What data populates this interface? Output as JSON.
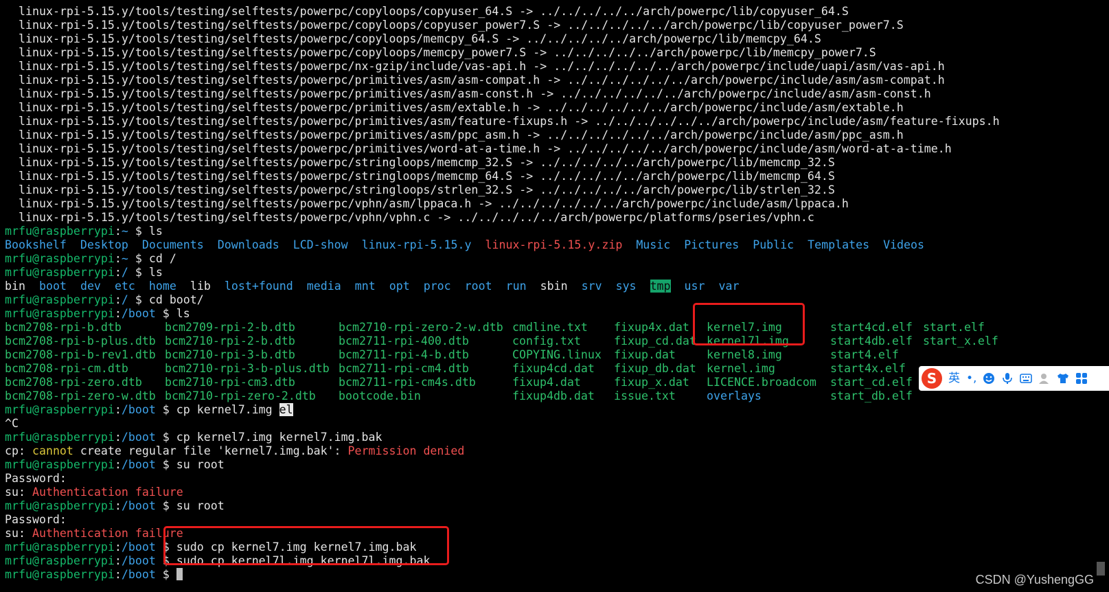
{
  "prompt": {
    "user": "mrfu@raspberrypi",
    "sep": ":",
    "dollar": " $ "
  },
  "symlink_lines": [
    "linux-rpi-5.15.y/tools/testing/selftests/powerpc/copyloops/copyuser_64.S -> ../../../../../arch/powerpc/lib/copyuser_64.S",
    "linux-rpi-5.15.y/tools/testing/selftests/powerpc/copyloops/copyuser_power7.S -> ../../../../../arch/powerpc/lib/copyuser_power7.S",
    "linux-rpi-5.15.y/tools/testing/selftests/powerpc/copyloops/memcpy_64.S -> ../../../../../arch/powerpc/lib/memcpy_64.S",
    "linux-rpi-5.15.y/tools/testing/selftests/powerpc/copyloops/memcpy_power7.S -> ../../../../../arch/powerpc/lib/memcpy_power7.S",
    "linux-rpi-5.15.y/tools/testing/selftests/powerpc/nx-gzip/include/vas-api.h -> ../../../../../../arch/powerpc/include/uapi/asm/vas-api.h",
    "linux-rpi-5.15.y/tools/testing/selftests/powerpc/primitives/asm/asm-compat.h -> ../../../../../../arch/powerpc/include/asm/asm-compat.h",
    "linux-rpi-5.15.y/tools/testing/selftests/powerpc/primitives/asm/asm-const.h -> ../../../../../../arch/powerpc/include/asm/asm-const.h",
    "linux-rpi-5.15.y/tools/testing/selftests/powerpc/primitives/asm/extable.h -> ../../../../../../arch/powerpc/include/asm/extable.h",
    "linux-rpi-5.15.y/tools/testing/selftests/powerpc/primitives/asm/feature-fixups.h -> ../../../../../../arch/powerpc/include/asm/feature-fixups.h",
    "linux-rpi-5.15.y/tools/testing/selftests/powerpc/primitives/asm/ppc_asm.h -> ../../../../../../arch/powerpc/include/asm/ppc_asm.h",
    "linux-rpi-5.15.y/tools/testing/selftests/powerpc/primitives/word-at-a-time.h -> ../../../../../arch/powerpc/include/asm/word-at-a-time.h",
    "linux-rpi-5.15.y/tools/testing/selftests/powerpc/stringloops/memcmp_32.S -> ../../../../../arch/powerpc/lib/memcmp_32.S",
    "linux-rpi-5.15.y/tools/testing/selftests/powerpc/stringloops/memcmp_64.S -> ../../../../../arch/powerpc/lib/memcmp_64.S",
    "linux-rpi-5.15.y/tools/testing/selftests/powerpc/stringloops/strlen_32.S -> ../../../../../arch/powerpc/lib/strlen_32.S",
    "linux-rpi-5.15.y/tools/testing/selftests/powerpc/vphn/asm/lppaca.h -> ../../../../../../arch/powerpc/include/asm/lppaca.h",
    "linux-rpi-5.15.y/tools/testing/selftests/powerpc/vphn/vphn.c -> ../../../../../arch/powerpc/platforms/pseries/vphn.c"
  ],
  "cmd1": {
    "path": "~",
    "cmd": "ls"
  },
  "home_ls": [
    {
      "name": "Bookshelf",
      "kind": "dir"
    },
    {
      "name": "Desktop",
      "kind": "dir"
    },
    {
      "name": "Documents",
      "kind": "dir"
    },
    {
      "name": "Downloads",
      "kind": "dir"
    },
    {
      "name": "LCD-show",
      "kind": "dir"
    },
    {
      "name": "linux-rpi-5.15.y",
      "kind": "dir"
    },
    {
      "name": "linux-rpi-5.15.y.zip",
      "kind": "zip"
    },
    {
      "name": "Music",
      "kind": "dir"
    },
    {
      "name": "Pictures",
      "kind": "dir"
    },
    {
      "name": "Public",
      "kind": "dir"
    },
    {
      "name": "Templates",
      "kind": "dir"
    },
    {
      "name": "Videos",
      "kind": "dir"
    }
  ],
  "cmd2": {
    "path": "~",
    "cmd": "cd /"
  },
  "cmd3": {
    "path": "/",
    "cmd": "ls"
  },
  "root_ls": [
    {
      "name": "bin",
      "kind": "plain"
    },
    {
      "name": "boot",
      "kind": "dir"
    },
    {
      "name": "dev",
      "kind": "dir"
    },
    {
      "name": "etc",
      "kind": "dir"
    },
    {
      "name": "home",
      "kind": "dir"
    },
    {
      "name": "lib",
      "kind": "plain"
    },
    {
      "name": "lost+found",
      "kind": "dir"
    },
    {
      "name": "media",
      "kind": "dir"
    },
    {
      "name": "mnt",
      "kind": "dir"
    },
    {
      "name": "opt",
      "kind": "dir"
    },
    {
      "name": "proc",
      "kind": "dir"
    },
    {
      "name": "root",
      "kind": "dir"
    },
    {
      "name": "run",
      "kind": "dir"
    },
    {
      "name": "sbin",
      "kind": "plain"
    },
    {
      "name": "srv",
      "kind": "dir"
    },
    {
      "name": "sys",
      "kind": "dir"
    },
    {
      "name": "tmp",
      "kind": "tmp"
    },
    {
      "name": "usr",
      "kind": "dir"
    },
    {
      "name": "var",
      "kind": "dir"
    }
  ],
  "cmd4": {
    "path": "/",
    "cmd": "cd boot/"
  },
  "cmd5": {
    "path": "/boot",
    "cmd": "ls"
  },
  "boot_ls": [
    [
      "bcm2708-rpi-b.dtb",
      "bcm2709-rpi-2-b.dtb",
      "bcm2710-rpi-zero-2-w.dtb",
      "cmdline.txt",
      "fixup4x.dat",
      "kernel7.img",
      "start4cd.elf",
      "start.elf"
    ],
    [
      "bcm2708-rpi-b-plus.dtb",
      "bcm2710-rpi-2-b.dtb",
      "bcm2711-rpi-400.dtb",
      "config.txt",
      "fixup_cd.dat",
      "kernel7l.img",
      "start4db.elf",
      "start_x.elf"
    ],
    [
      "bcm2708-rpi-b-rev1.dtb",
      "bcm2710-rpi-3-b.dtb",
      "bcm2711-rpi-4-b.dtb",
      "COPYING.linux",
      "fixup.dat",
      "kernel8.img",
      "start4.elf",
      ""
    ],
    [
      "bcm2708-rpi-cm.dtb",
      "bcm2710-rpi-3-b-plus.dtb",
      "bcm2711-rpi-cm4.dtb",
      "fixup4cd.dat",
      "fixup_db.dat",
      "kernel.img",
      "start4x.elf",
      ""
    ],
    [
      "bcm2708-rpi-zero.dtb",
      "bcm2710-rpi-cm3.dtb",
      "bcm2711-rpi-cm4s.dtb",
      "fixup4.dat",
      "fixup_x.dat",
      "LICENCE.broadcom",
      "start_cd.elf",
      ""
    ],
    [
      "bcm2708-rpi-zero-w.dtb",
      "bcm2710-rpi-zero-2.dtb",
      "bootcode.bin",
      "fixup4db.dat",
      "issue.txt",
      "overlays",
      "start_db.elf",
      ""
    ]
  ],
  "boot_ls_kinds": [
    [
      "plain",
      "plain",
      "plain",
      "plain",
      "plain",
      "plain",
      "plain",
      "plain"
    ],
    [
      "plain",
      "plain",
      "plain",
      "plain",
      "plain",
      "plain",
      "plain",
      "plain"
    ],
    [
      "plain",
      "plain",
      "plain",
      "plain",
      "plain",
      "plain",
      "plain",
      "plain"
    ],
    [
      "plain",
      "plain",
      "plain",
      "plain",
      "plain",
      "plain",
      "plain",
      "plain"
    ],
    [
      "plain",
      "plain",
      "plain",
      "plain",
      "plain",
      "plain",
      "plain",
      "plain"
    ],
    [
      "plain",
      "plain",
      "plain",
      "plain",
      "plain",
      "dir",
      "plain",
      "plain"
    ]
  ],
  "cmd6": {
    "path": "/boot",
    "cmd": "cp kernel7.img ",
    "selected": "el"
  },
  "interrupt": "^C",
  "cmd7": {
    "path": "/boot",
    "cmd": "cp kernel7.img kernel7.img.bak"
  },
  "cp_error": {
    "prefix": "cp: ",
    "cannot": "cannot",
    "mid": " create regular file 'kernel7.img.bak': ",
    "denied": "Permission denied"
  },
  "cmd8": {
    "path": "/boot",
    "cmd": "su root"
  },
  "password_prompt": "Password:",
  "su_error": {
    "prefix": "su: ",
    "msg": "Authentication failure"
  },
  "cmd9": {
    "path": "/boot",
    "cmd": "su root"
  },
  "cmd10": {
    "path": "/boot",
    "cmd": "sudo cp kernel7.img kernel7.img.bak"
  },
  "cmd11": {
    "path": "/boot",
    "cmd": "sudo cp kernel7l.img kernel7l.img.bak"
  },
  "cmd12": {
    "path": "/boot",
    "cmd": ""
  },
  "ime": {
    "logo": "S",
    "lang": "英",
    "punct": "•,",
    "icons": [
      "emoji-icon",
      "mic-icon",
      "keyboard-icon",
      "user-icon",
      "shirt-icon",
      "grid-icon"
    ]
  },
  "watermark": "CSDN @YushengGG",
  "colors": {
    "prompt": "#15b86a",
    "dir": "#3ea3ea",
    "zip": "#f05050",
    "error": "#f05050",
    "warn": "#d8c43a",
    "highlight_box": "#e81c1c"
  }
}
